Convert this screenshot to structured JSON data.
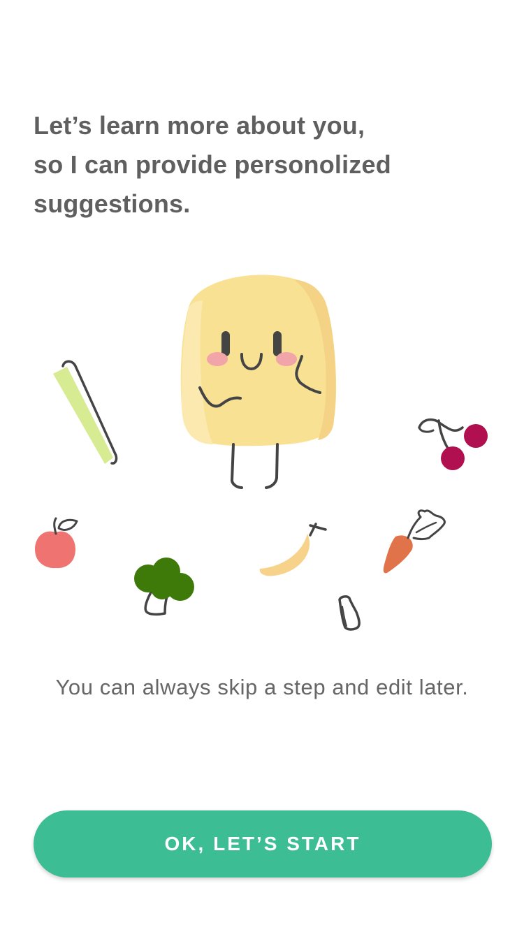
{
  "intro": {
    "line1": "Let’s learn more about you,",
    "line2": "so I can provide personolized",
    "line3": "suggestions."
  },
  "illustration": {
    "character": "potato-mascot",
    "items": [
      "celery-icon",
      "apple-icon",
      "broccoli-icon",
      "banana-icon",
      "milk-bottle-icon",
      "carrot-icon",
      "cherries-icon"
    ],
    "colors": {
      "potato": "#f9e193",
      "cheeks": "#f2a5a8",
      "celery": "#d6eb92",
      "apple": "#ef7471",
      "broccoli": "#3e7a0a",
      "banana": "#f7d28a",
      "carrot": "#e0734a",
      "cherry": "#b0104f",
      "outline": "#444444"
    }
  },
  "hint": "You can always skip a step and edit later.",
  "cta": {
    "label": "OK, LET’S START",
    "color": "#3dbd94"
  }
}
